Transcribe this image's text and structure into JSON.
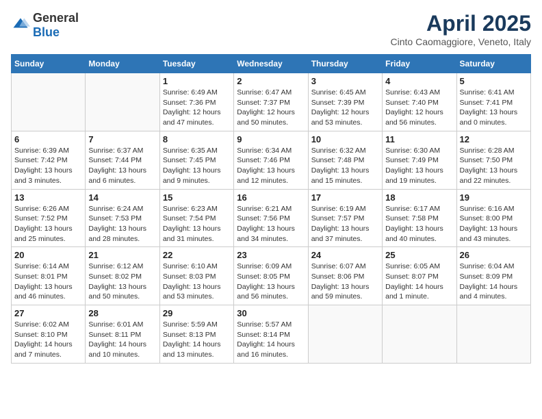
{
  "logo": {
    "general": "General",
    "blue": "Blue"
  },
  "title": "April 2025",
  "subtitle": "Cinto Caomaggiore, Veneto, Italy",
  "weekdays": [
    "Sunday",
    "Monday",
    "Tuesday",
    "Wednesday",
    "Thursday",
    "Friday",
    "Saturday"
  ],
  "weeks": [
    [
      {
        "day": "",
        "info": ""
      },
      {
        "day": "",
        "info": ""
      },
      {
        "day": "1",
        "info": "Sunrise: 6:49 AM\nSunset: 7:36 PM\nDaylight: 12 hours and 47 minutes."
      },
      {
        "day": "2",
        "info": "Sunrise: 6:47 AM\nSunset: 7:37 PM\nDaylight: 12 hours and 50 minutes."
      },
      {
        "day": "3",
        "info": "Sunrise: 6:45 AM\nSunset: 7:39 PM\nDaylight: 12 hours and 53 minutes."
      },
      {
        "day": "4",
        "info": "Sunrise: 6:43 AM\nSunset: 7:40 PM\nDaylight: 12 hours and 56 minutes."
      },
      {
        "day": "5",
        "info": "Sunrise: 6:41 AM\nSunset: 7:41 PM\nDaylight: 13 hours and 0 minutes."
      }
    ],
    [
      {
        "day": "6",
        "info": "Sunrise: 6:39 AM\nSunset: 7:42 PM\nDaylight: 13 hours and 3 minutes."
      },
      {
        "day": "7",
        "info": "Sunrise: 6:37 AM\nSunset: 7:44 PM\nDaylight: 13 hours and 6 minutes."
      },
      {
        "day": "8",
        "info": "Sunrise: 6:35 AM\nSunset: 7:45 PM\nDaylight: 13 hours and 9 minutes."
      },
      {
        "day": "9",
        "info": "Sunrise: 6:34 AM\nSunset: 7:46 PM\nDaylight: 13 hours and 12 minutes."
      },
      {
        "day": "10",
        "info": "Sunrise: 6:32 AM\nSunset: 7:48 PM\nDaylight: 13 hours and 15 minutes."
      },
      {
        "day": "11",
        "info": "Sunrise: 6:30 AM\nSunset: 7:49 PM\nDaylight: 13 hours and 19 minutes."
      },
      {
        "day": "12",
        "info": "Sunrise: 6:28 AM\nSunset: 7:50 PM\nDaylight: 13 hours and 22 minutes."
      }
    ],
    [
      {
        "day": "13",
        "info": "Sunrise: 6:26 AM\nSunset: 7:52 PM\nDaylight: 13 hours and 25 minutes."
      },
      {
        "day": "14",
        "info": "Sunrise: 6:24 AM\nSunset: 7:53 PM\nDaylight: 13 hours and 28 minutes."
      },
      {
        "day": "15",
        "info": "Sunrise: 6:23 AM\nSunset: 7:54 PM\nDaylight: 13 hours and 31 minutes."
      },
      {
        "day": "16",
        "info": "Sunrise: 6:21 AM\nSunset: 7:56 PM\nDaylight: 13 hours and 34 minutes."
      },
      {
        "day": "17",
        "info": "Sunrise: 6:19 AM\nSunset: 7:57 PM\nDaylight: 13 hours and 37 minutes."
      },
      {
        "day": "18",
        "info": "Sunrise: 6:17 AM\nSunset: 7:58 PM\nDaylight: 13 hours and 40 minutes."
      },
      {
        "day": "19",
        "info": "Sunrise: 6:16 AM\nSunset: 8:00 PM\nDaylight: 13 hours and 43 minutes."
      }
    ],
    [
      {
        "day": "20",
        "info": "Sunrise: 6:14 AM\nSunset: 8:01 PM\nDaylight: 13 hours and 46 minutes."
      },
      {
        "day": "21",
        "info": "Sunrise: 6:12 AM\nSunset: 8:02 PM\nDaylight: 13 hours and 50 minutes."
      },
      {
        "day": "22",
        "info": "Sunrise: 6:10 AM\nSunset: 8:03 PM\nDaylight: 13 hours and 53 minutes."
      },
      {
        "day": "23",
        "info": "Sunrise: 6:09 AM\nSunset: 8:05 PM\nDaylight: 13 hours and 56 minutes."
      },
      {
        "day": "24",
        "info": "Sunrise: 6:07 AM\nSunset: 8:06 PM\nDaylight: 13 hours and 59 minutes."
      },
      {
        "day": "25",
        "info": "Sunrise: 6:05 AM\nSunset: 8:07 PM\nDaylight: 14 hours and 1 minute."
      },
      {
        "day": "26",
        "info": "Sunrise: 6:04 AM\nSunset: 8:09 PM\nDaylight: 14 hours and 4 minutes."
      }
    ],
    [
      {
        "day": "27",
        "info": "Sunrise: 6:02 AM\nSunset: 8:10 PM\nDaylight: 14 hours and 7 minutes."
      },
      {
        "day": "28",
        "info": "Sunrise: 6:01 AM\nSunset: 8:11 PM\nDaylight: 14 hours and 10 minutes."
      },
      {
        "day": "29",
        "info": "Sunrise: 5:59 AM\nSunset: 8:13 PM\nDaylight: 14 hours and 13 minutes."
      },
      {
        "day": "30",
        "info": "Sunrise: 5:57 AM\nSunset: 8:14 PM\nDaylight: 14 hours and 16 minutes."
      },
      {
        "day": "",
        "info": ""
      },
      {
        "day": "",
        "info": ""
      },
      {
        "day": "",
        "info": ""
      }
    ]
  ]
}
